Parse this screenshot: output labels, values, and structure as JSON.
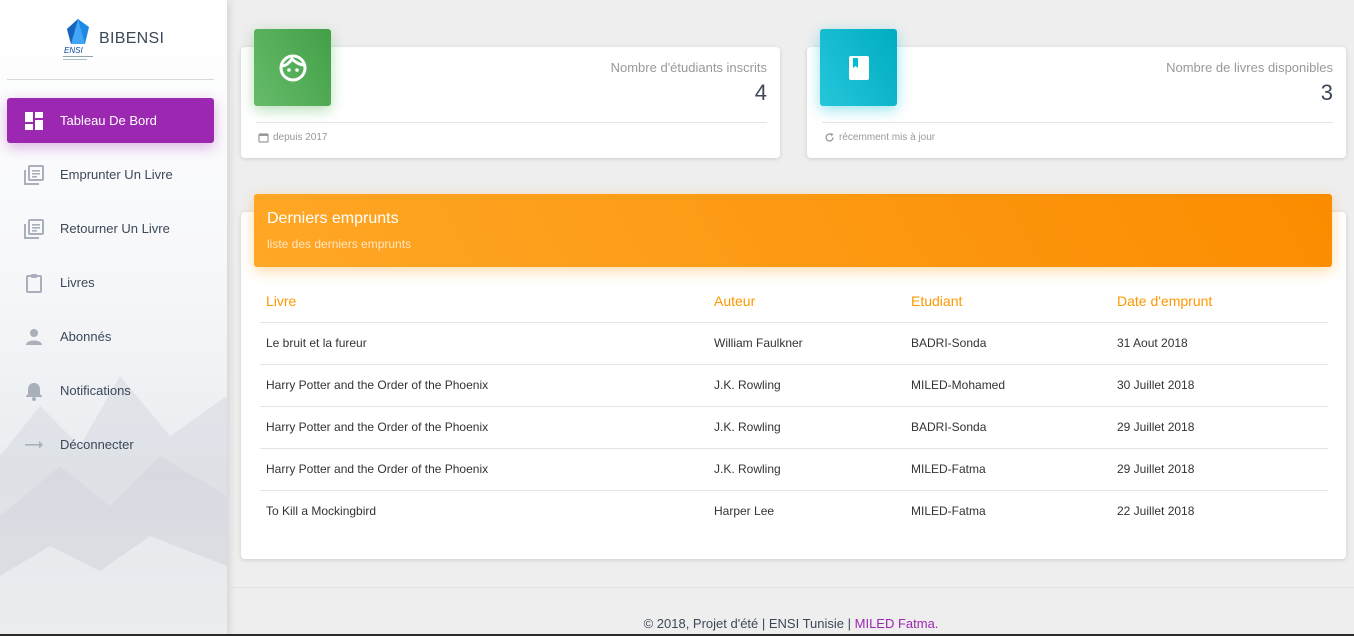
{
  "brand": {
    "name": "BIBENSI",
    "logo_text": "ENSI",
    "logo_color": "#1e88e5"
  },
  "sidebar": {
    "items": [
      {
        "label": "Tableau De Bord",
        "icon": "dashboard-icon",
        "active": true
      },
      {
        "label": "Emprunter Un Livre",
        "icon": "library-books-icon"
      },
      {
        "label": "Retourner Un Livre",
        "icon": "library-books-icon"
      },
      {
        "label": "Livres",
        "icon": "clipboard-icon"
      },
      {
        "label": "Abonnés",
        "icon": "person-icon"
      },
      {
        "label": "Notifications",
        "icon": "bell-icon"
      },
      {
        "label": "Déconnecter",
        "icon": "arrow-right-icon"
      }
    ],
    "active_color": "#9c27b0"
  },
  "stats": {
    "students": {
      "title": "Nombre d'étudiants inscrits",
      "value": "4",
      "footer": "depuis 2017",
      "icon": "face-icon",
      "color": "#4caf50"
    },
    "books": {
      "title": "Nombre de livres disponibles",
      "value": "3",
      "footer": "récemment mis à jour",
      "icon": "book-icon",
      "color": "#00bcd4"
    }
  },
  "loans": {
    "title": "Derniers emprunts",
    "subtitle": "liste des derniers emprunts",
    "color": "#ff9800",
    "columns": [
      "Livre",
      "Auteur",
      "Etudiant",
      "Date d'emprunt"
    ],
    "rows": [
      [
        "Le bruit et la fureur",
        "William Faulkner",
        "BADRI-Sonda",
        "31 Aout 2018"
      ],
      [
        "Harry Potter and the Order of the Phoenix",
        "J.K. Rowling",
        "MILED-Mohamed",
        "30 Juillet 2018"
      ],
      [
        "Harry Potter and the Order of the Phoenix",
        "J.K. Rowling",
        "BADRI-Sonda",
        "29 Juillet 2018"
      ],
      [
        "Harry Potter and the Order of the Phoenix",
        "J.K. Rowling",
        "MILED-Fatma",
        "29 Juillet 2018"
      ],
      [
        "To Kill a Mockingbird",
        "Harper Lee",
        "MILED-Fatma",
        "22 Juillet 2018"
      ]
    ]
  },
  "footer": {
    "text": "© 2018, Projet d'été | ENSI Tunisie | ",
    "author": "MILED Fatma."
  }
}
